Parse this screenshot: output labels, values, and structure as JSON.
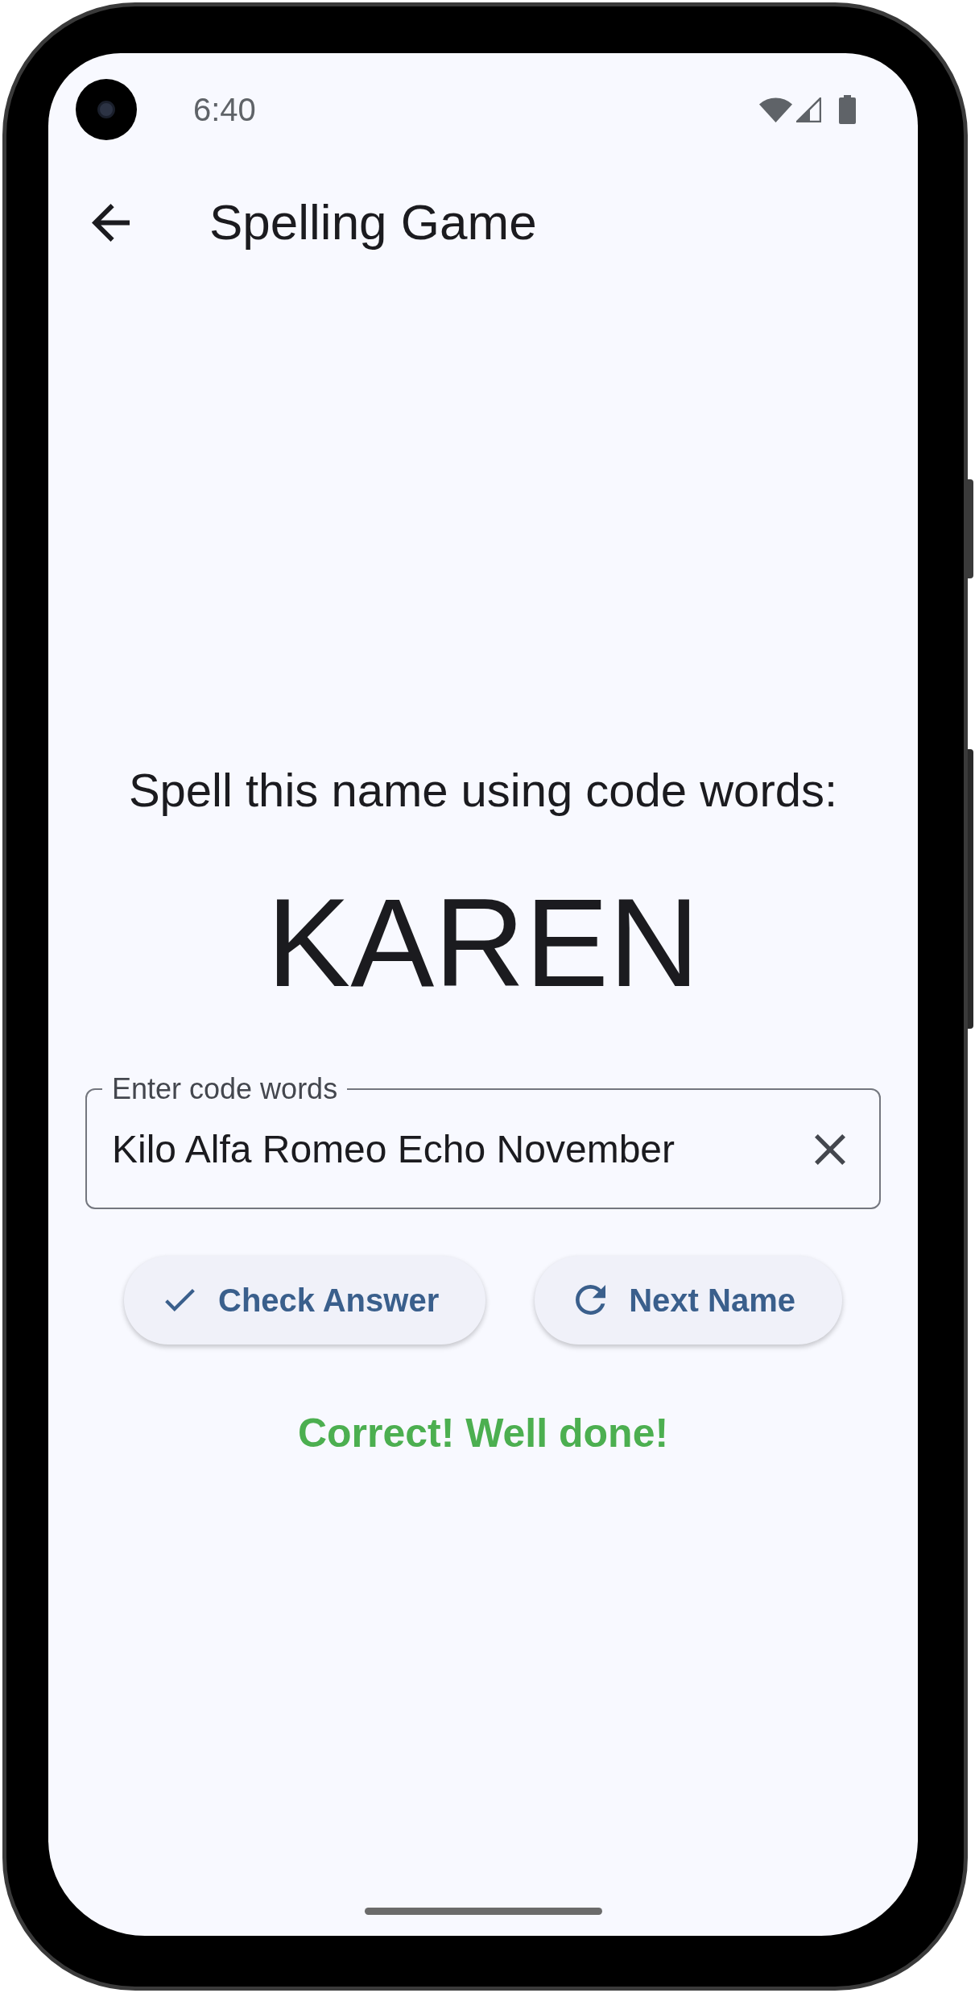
{
  "status_bar": {
    "time": "6:40"
  },
  "app_bar": {
    "title": "Spelling Game"
  },
  "prompt": "Spell this name using code words:",
  "name": "KAREN",
  "input": {
    "label": "Enter code words",
    "value": "Kilo Alfa Romeo Echo November"
  },
  "buttons": [
    {
      "kind": "check",
      "label": "Check Answer"
    },
    {
      "kind": "refresh",
      "label": "Next Name"
    }
  ],
  "feedback": {
    "kind": "success",
    "text": "Correct! Well done!"
  }
}
